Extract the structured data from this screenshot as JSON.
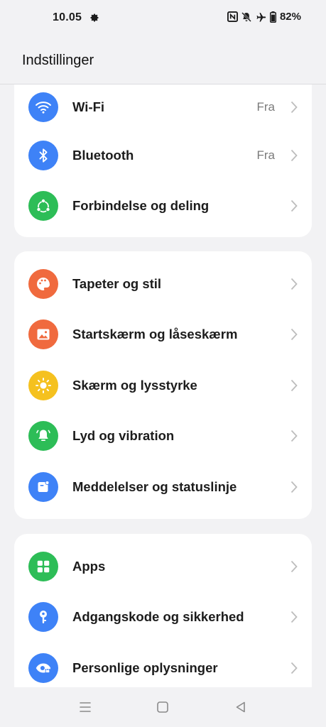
{
  "status_bar": {
    "time": "10.05",
    "battery": "82%",
    "icons": [
      "settings-gear-icon",
      "nfc-icon",
      "bell-muted-icon",
      "airplane-icon",
      "battery-icon"
    ]
  },
  "header": {
    "title": "Indstillinger"
  },
  "groups": [
    {
      "items": [
        {
          "label": "Wi-Fi",
          "value": "Fra",
          "icon": "wifi-icon",
          "color": "#3e82f7"
        },
        {
          "label": "Bluetooth",
          "value": "Fra",
          "icon": "bluetooth-icon",
          "color": "#3e82f7"
        },
        {
          "label": "Forbindelse og deling",
          "value": "",
          "icon": "connection-sharing-icon",
          "color": "#2dbd57"
        }
      ]
    },
    {
      "items": [
        {
          "label": "Tapeter og stil",
          "value": "",
          "icon": "palette-icon",
          "color": "#f06a3e"
        },
        {
          "label": "Startskærm og låseskærm",
          "value": "",
          "icon": "image-icon",
          "color": "#f06a3e"
        },
        {
          "label": "Skærm og lysstyrke",
          "value": "",
          "icon": "sun-icon",
          "color": "#f5c11f"
        },
        {
          "label": "Lyd og vibration",
          "value": "",
          "icon": "bell-icon",
          "color": "#2dbd57"
        },
        {
          "label": "Meddelelser og statuslinje",
          "value": "",
          "icon": "notification-icon",
          "color": "#3e82f7"
        }
      ]
    },
    {
      "items": [
        {
          "label": "Apps",
          "value": "",
          "icon": "apps-grid-icon",
          "color": "#2dbd57"
        },
        {
          "label": "Adgangskode og sikkerhed",
          "value": "",
          "icon": "key-icon",
          "color": "#3e82f7"
        },
        {
          "label": "Personlige oplysninger",
          "value": "",
          "icon": "privacy-eye-icon",
          "color": "#3e82f7"
        }
      ]
    }
  ],
  "nav_bar": {
    "buttons": [
      "menu-icon",
      "home-icon",
      "back-icon"
    ]
  }
}
